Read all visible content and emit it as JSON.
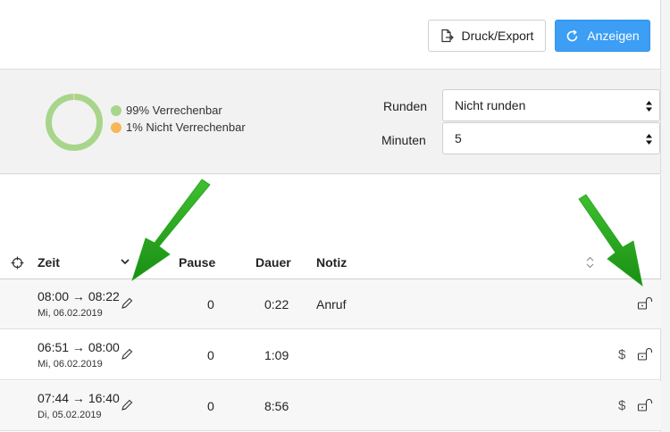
{
  "toolbar": {
    "export_label": "Druck/Export",
    "show_label": "Anzeigen",
    "show_color": "#3c9ef5"
  },
  "summary": {
    "donut": {
      "billable_percent": 99,
      "non_billable_percent": 1
    },
    "legend": [
      {
        "label": "99% Verrechenbar",
        "color": "#a8d58b"
      },
      {
        "label": "1% Nicht Verrechenbar",
        "color": "#f7b756"
      }
    ],
    "rounding": {
      "label": "Runden",
      "value": "Nicht runden"
    },
    "minutes": {
      "label": "Minuten",
      "value": "5"
    }
  },
  "table": {
    "headers": {
      "zeit": "Zeit",
      "pause": "Pause",
      "dauer": "Dauer",
      "notiz": "Notiz"
    },
    "rows": [
      {
        "time_range": "08:00 → 08:22",
        "date": "Mi, 06.02.2019",
        "pause": "0",
        "dauer": "0:22",
        "notiz": "Anruf",
        "billable_marker": false
      },
      {
        "time_range": "06:51 → 08:00",
        "date": "Mi, 06.02.2019",
        "pause": "0",
        "dauer": "1:09",
        "notiz": "",
        "billable_marker": true,
        "dollar": "$"
      },
      {
        "time_range": "07:44 → 16:40",
        "date": "Di, 05.02.2019",
        "pause": "0",
        "dauer": "8:56",
        "notiz": "",
        "billable_marker": true,
        "dollar": "$"
      }
    ]
  },
  "annotations": {
    "arrow_color": "#22a31b"
  }
}
